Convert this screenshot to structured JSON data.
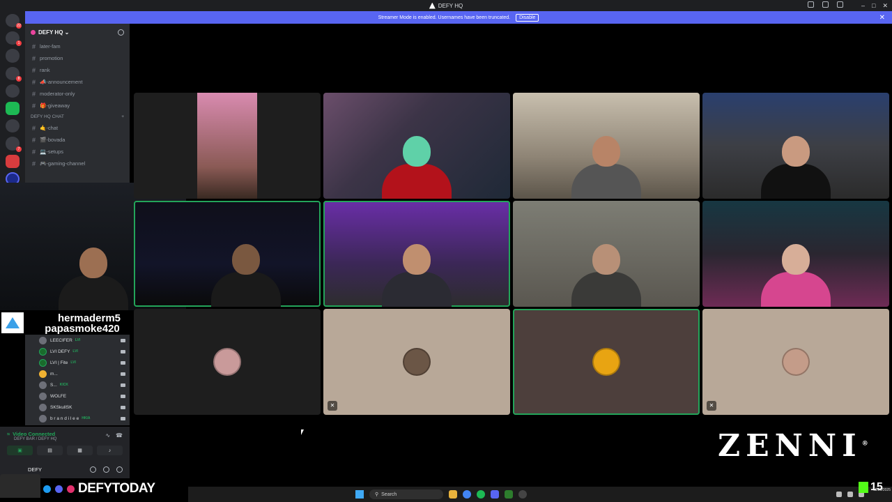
{
  "app": {
    "title": "DEFY HQ"
  },
  "banner": {
    "text": "Streamer Mode is enabled. Usernames have been truncated.",
    "disable_label": "Disable"
  },
  "guilds": [
    {
      "badge": "22",
      "style": ""
    },
    {
      "badge": "1",
      "style": ""
    },
    {
      "badge": "",
      "style": ""
    },
    {
      "badge": "8",
      "style": ""
    },
    {
      "badge": "",
      "style": ""
    },
    {
      "badge": "",
      "style": "green"
    },
    {
      "badge": "",
      "style": ""
    },
    {
      "badge": "7",
      "style": ""
    },
    {
      "badge": "",
      "style": "red"
    },
    {
      "badge": "",
      "style": "blue"
    }
  ],
  "sidebar": {
    "server_name": "DEFY HQ",
    "channels_top": [
      "later-fam",
      "promotion",
      "rank",
      "📣-announcement",
      "moderator-only",
      "🎁-giveaway"
    ],
    "category": "DEFY HQ CHAT",
    "channels_chat": [
      "🤙-chat",
      "🎬-bovada",
      "💻-setups",
      "🎮-gaming-channel"
    ]
  },
  "voice_users": [
    {
      "name": "LEECIFER",
      "tag": "LVI",
      "av": ""
    },
    {
      "name": "LVI DEFY",
      "tag": "LVI",
      "av": "g"
    },
    {
      "name": "LVI | Fite",
      "tag": "LVI",
      "av": "g"
    },
    {
      "name": "m...",
      "tag": "",
      "av": "y"
    },
    {
      "name": "S...",
      "tag": "KICK",
      "av": ""
    },
    {
      "name": "WOLFE",
      "tag": "",
      "av": ""
    },
    {
      "name": "SKSkullSK",
      "tag": "",
      "av": ""
    },
    {
      "name": "b r a n d i l e e",
      "tag": "HKIA",
      "av": ""
    }
  ],
  "voice_panel": {
    "status": "Video Connected",
    "location": "DEFY BAR / DEFY HQ"
  },
  "user_panel": {
    "username": "DEFY"
  },
  "overlay": {
    "name_line1": "hermaderm5",
    "name_line2": "papasmoke420",
    "social_handle": "DEFYTODAY",
    "brand": "ZENNI",
    "brand_mark": "®",
    "kick_viewers": "15"
  },
  "taskbar": {
    "search_placeholder": "Search",
    "date": "12/20/2025"
  },
  "colors": {
    "accent": "#5865f2",
    "speaking": "#23a55a",
    "kick_green": "#53fc18"
  }
}
